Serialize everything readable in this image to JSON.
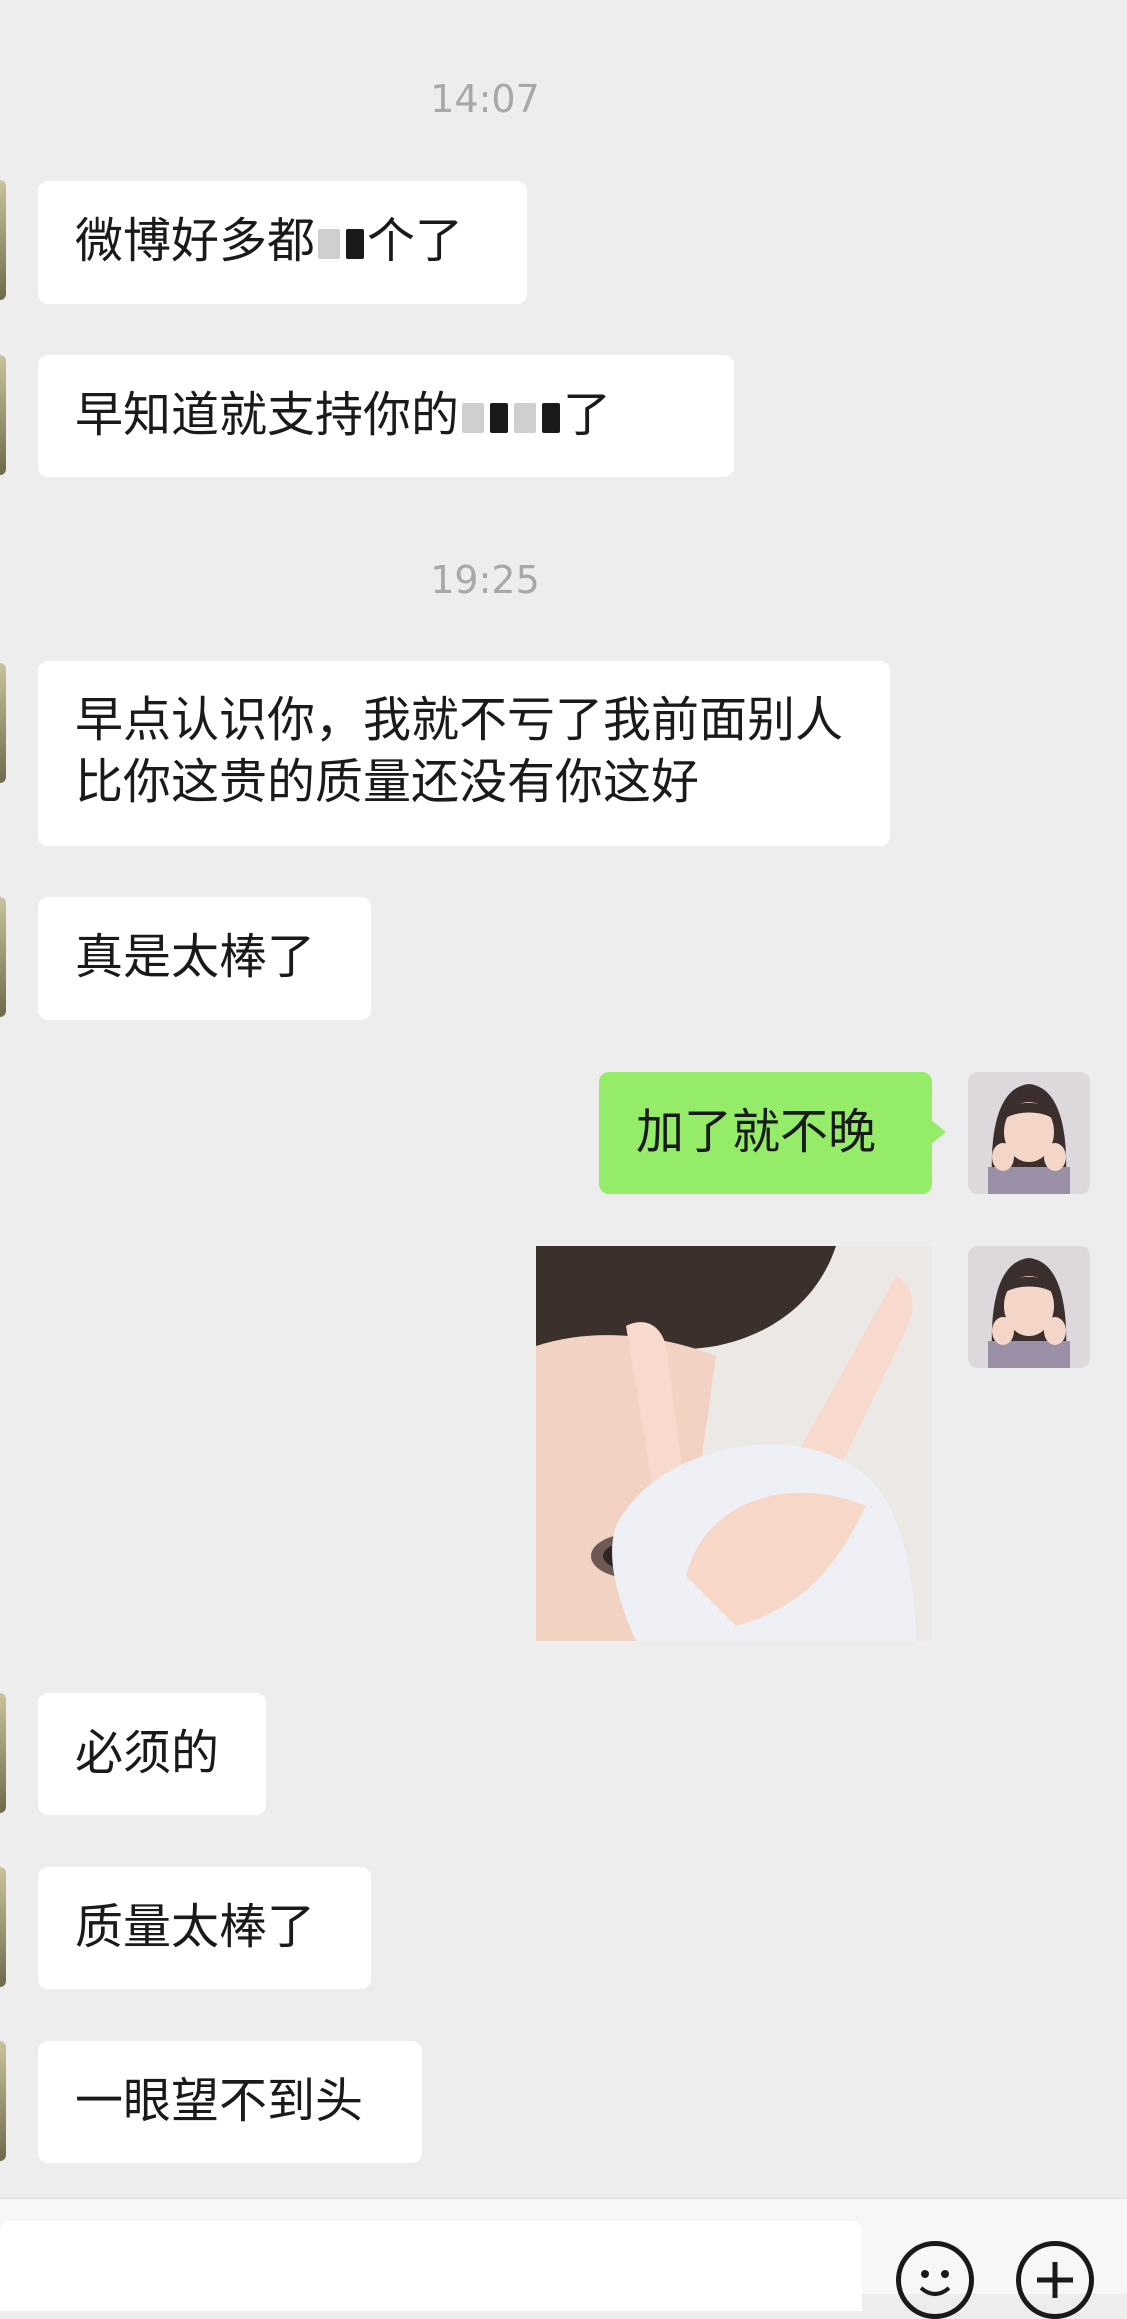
{
  "chat": {
    "time_1": "14:07",
    "time_2": "19:25",
    "messages": {
      "m1_a": "微博好多都",
      "m1_b": "个了",
      "m2_a": "早知道就支持你的",
      "m2_b": "了",
      "m3": "早点认识你，我就不亏了我前面别人比你这贵的质量还没有你这好",
      "m4": "真是太棒了",
      "m5": "加了就不晚",
      "m7": "必须的",
      "m8": "质量太棒了",
      "m9": "一眼望不到头"
    }
  },
  "input_bar": {
    "emoji_icon": "emoji-icon",
    "plus_icon": "plus-icon"
  },
  "colors": {
    "background": "#ededed",
    "incoming_bubble": "#ffffff",
    "outgoing_bubble": "#95ec69",
    "timestamp": "#a8a8a8"
  }
}
